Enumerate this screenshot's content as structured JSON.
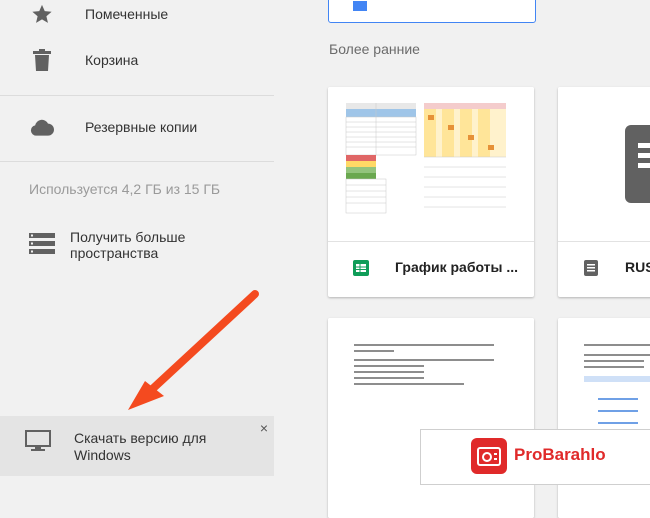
{
  "sidebar": {
    "items": [
      {
        "label": "Помеченные",
        "icon": "star-icon"
      },
      {
        "label": "Корзина",
        "icon": "trash-icon"
      },
      {
        "label": "Резервные копии",
        "icon": "cloud-icon"
      }
    ],
    "storage_usage": "Используется 4,2 ГБ из 15 ГБ",
    "more_space_label": "Получить больше пространства",
    "download": {
      "label": "Скачать версию для Windows",
      "close": "×",
      "icon": "monitor-icon"
    }
  },
  "main": {
    "section_title": "Более ранние",
    "files": [
      {
        "title": "График работы ...",
        "icon": "sheets-icon",
        "icon_color": "#0f9d58"
      },
      {
        "title": "RUS",
        "icon": "docs-icon",
        "icon_color": "#616161"
      }
    ]
  },
  "watermark": {
    "text": "ProBarahlo"
  },
  "colors": {
    "accent": "#4285f4",
    "arrow": "#f44a1f",
    "sheets": "#0f9d58"
  }
}
